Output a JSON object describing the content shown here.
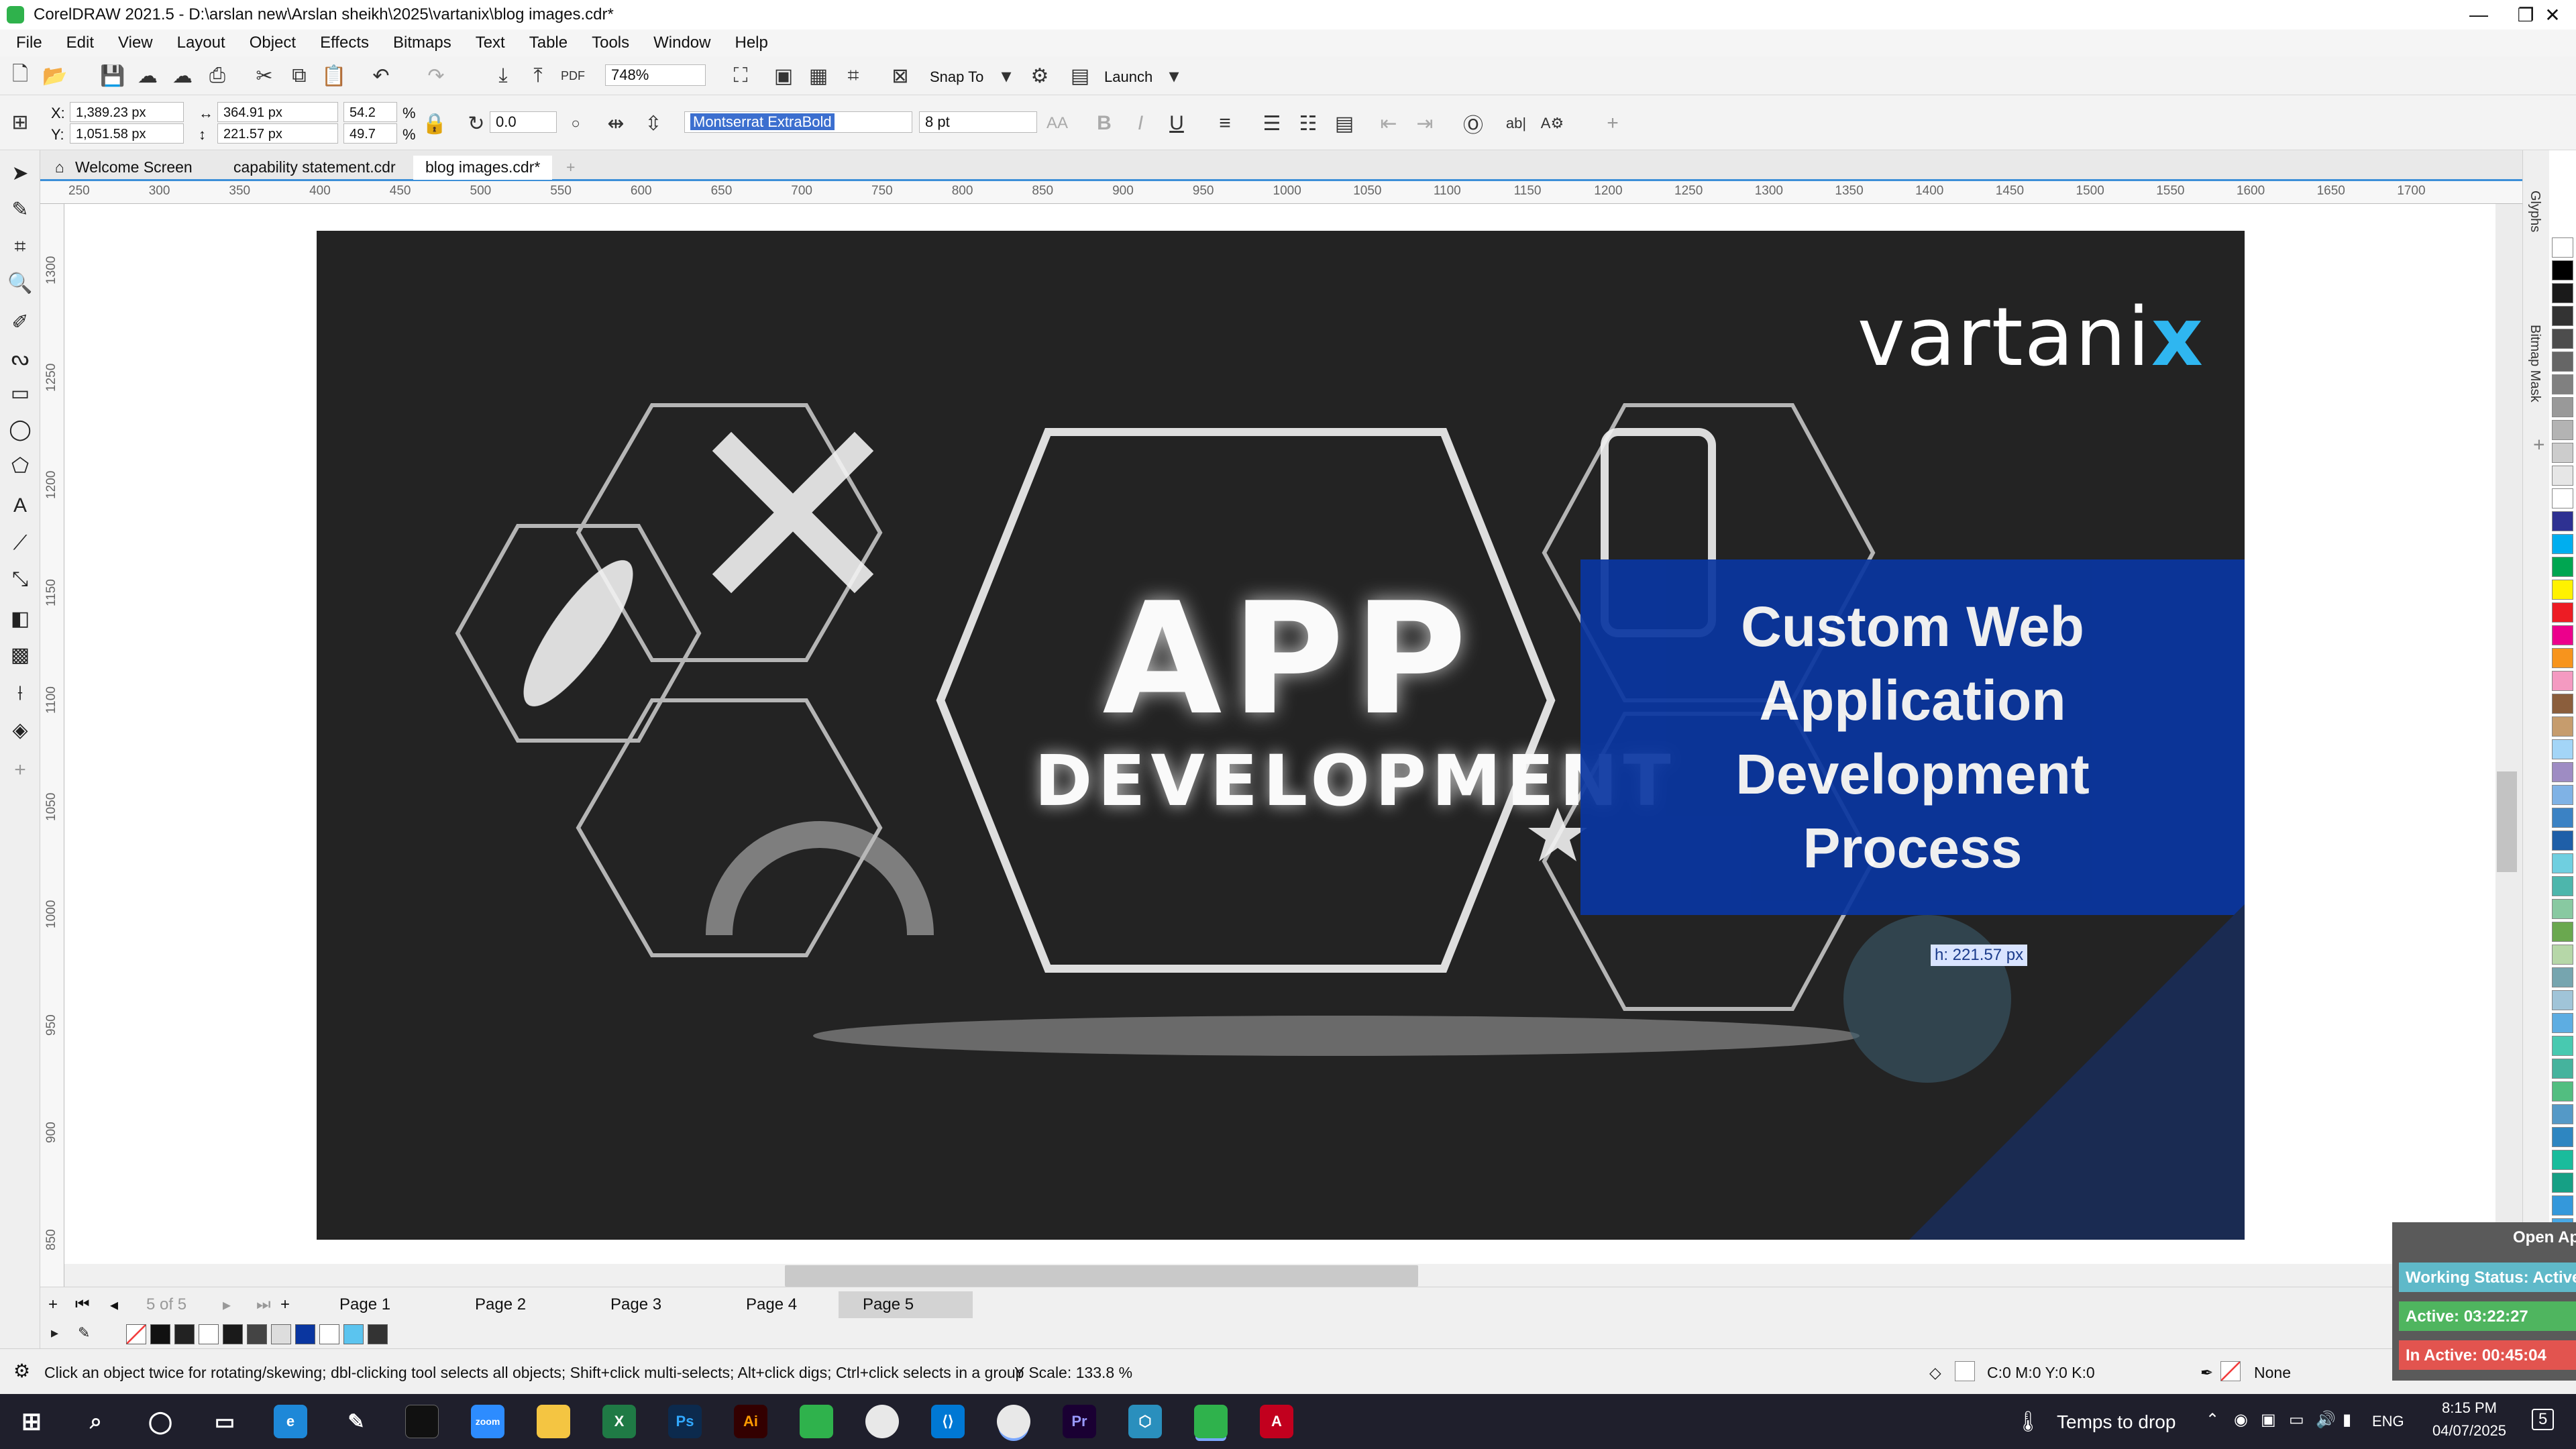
{
  "window": {
    "title": "CorelDRAW 2021.5 - D:\\arslan new\\Arslan sheikh\\2025\\vartanix\\blog images.cdr*",
    "minimize": "—",
    "restore": "❐",
    "close": "✕"
  },
  "menu": [
    "File",
    "Edit",
    "View",
    "Layout",
    "Object",
    "Effects",
    "Bitmaps",
    "Text",
    "Table",
    "Tools",
    "Window",
    "Help"
  ],
  "toolbar": {
    "zoom": "748%",
    "snap_to": "Snap To",
    "launch": "Launch"
  },
  "properties": {
    "x": "1,389.23 px",
    "y": "1,051.58 px",
    "width": "364.91 px",
    "height": "221.57 px",
    "scale_w": "54.2",
    "scale_h": "49.7",
    "percent": "%",
    "rotation": "0.0",
    "font": "Montserrat ExtraBold",
    "font_size": "8 pt",
    "bold": "B",
    "italic": "I",
    "underline": "U"
  },
  "tabs": [
    "Welcome Screen",
    "capability statement.cdr",
    "blog images.cdr*"
  ],
  "ruler": {
    "h_ticks": [
      "250",
      "300",
      "350",
      "400",
      "450",
      "500",
      "550",
      "600",
      "650",
      "700",
      "750",
      "800",
      "850",
      "900",
      "950",
      "1000",
      "1050",
      "1100",
      "1150",
      "1200",
      "1250",
      "1300",
      "1350",
      "1400",
      "1450",
      "1500",
      "1550",
      "1600",
      "1650",
      "1700"
    ],
    "v_ticks": [
      "1300",
      "1250",
      "1200",
      "1150",
      "1100",
      "1050",
      "1000",
      "950",
      "900",
      "850"
    ],
    "unit": "pixels"
  },
  "artwork": {
    "logo_main": "vartani",
    "logo_x": "x",
    "app": "APP",
    "development": "DEVELOPMENT",
    "heading_lines": [
      "Custom Web",
      "Application",
      "Development",
      "Process"
    ],
    "height_hint": "h: 221.57 px"
  },
  "docker": [
    "Glyphs",
    "Bitmap Mask"
  ],
  "pages": {
    "counter": "5 of 5",
    "tabs": [
      "Page 1",
      "Page 2",
      "Page 3",
      "Page 4",
      "Page 5"
    ],
    "active": "Page 5"
  },
  "status": {
    "hint": "Click an object twice for rotating/skewing; dbl-clicking tool selects all objects; Shift+click multi-selects; Alt+click digs; Ctrl+click selects in a group",
    "y_scale": "Y Scale: 133.8 %",
    "fill": "C:0 M:0 Y:0 K:0",
    "outline": "None"
  },
  "popup": {
    "open_app": "Open Ap",
    "working": "Working Status: Active",
    "active": "Active: 03:22:27",
    "inactive": "In Active: 00:45:04"
  },
  "taskbar": {
    "weather": "Temps to drop",
    "lang": "ENG",
    "time": "8:15 PM",
    "date": "04/07/2025",
    "notifications": "5"
  },
  "colors": {
    "accent": "#3c8fd8",
    "panel_blue": "#0a36a0",
    "logo_cyan": "#2fb6f0"
  }
}
